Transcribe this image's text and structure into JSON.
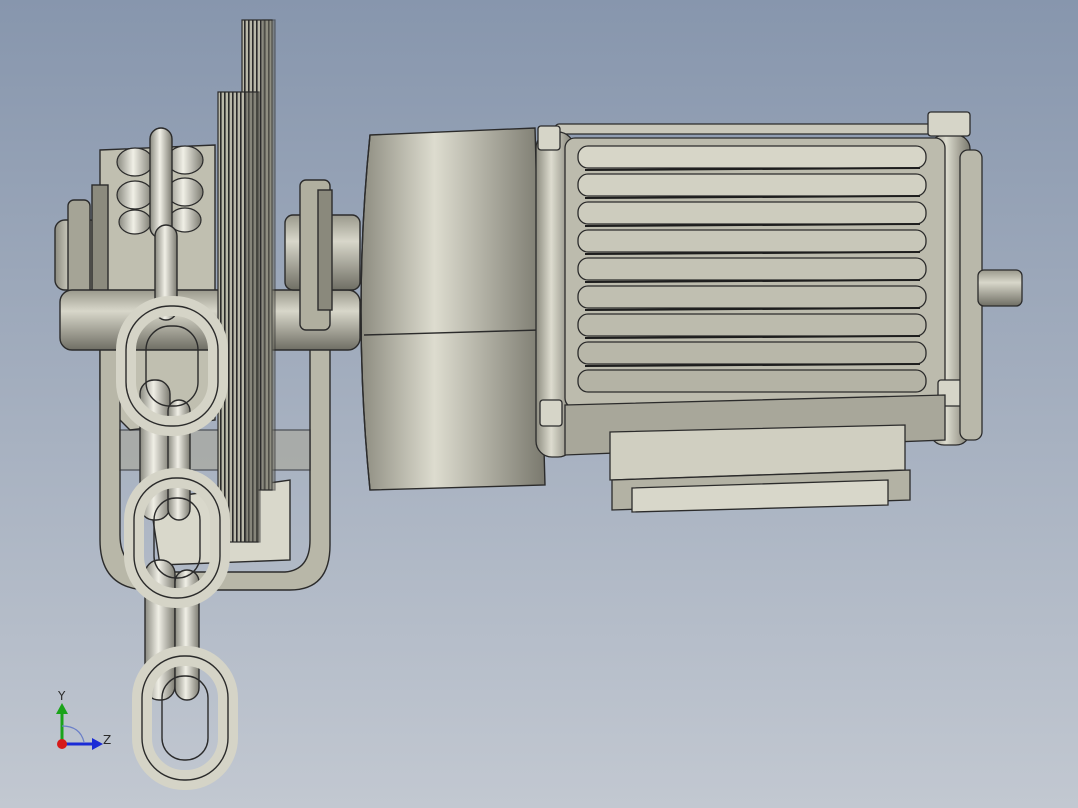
{
  "viewport": {
    "background_top": "#8796ad",
    "background_bottom": "#c2c8d1"
  },
  "model": {
    "metal_color": "#c7c6b6",
    "edge_color": "#2b2b2b",
    "shadow_color": "#7c7b70"
  },
  "triad": {
    "y_label": "Y",
    "z_label": "Z",
    "y_color": "#1aa31a",
    "z_color": "#1a2bd6",
    "x_color": "#d61a1a"
  }
}
